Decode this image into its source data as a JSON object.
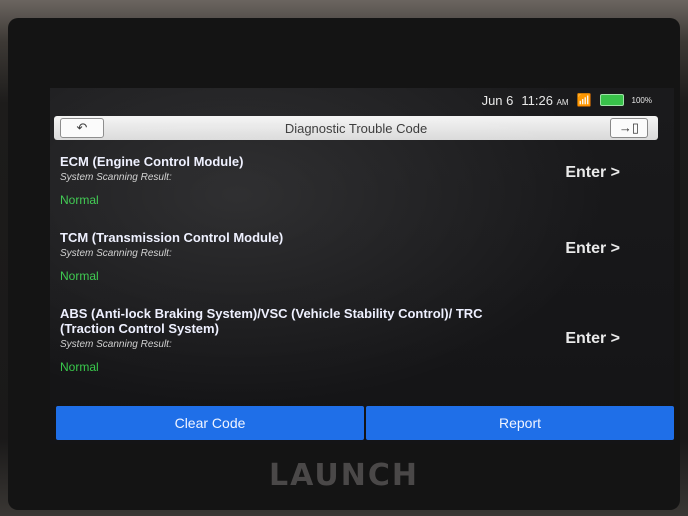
{
  "status_bar": {
    "date": "Jun 6",
    "time": "11:26",
    "ampm": "AM",
    "battery": "100%"
  },
  "title_bar": {
    "title": "Diagnostic Trouble Code"
  },
  "modules": [
    {
      "name": "ECM (Engine Control Module)",
      "sub": "System Scanning Result:",
      "status": "Normal",
      "enter": "Enter >"
    },
    {
      "name": "TCM (Transmission Control Module)",
      "sub": "System Scanning Result:",
      "status": "Normal",
      "enter": "Enter >"
    },
    {
      "name": "ABS (Anti-lock Braking System)/VSC (Vehicle Stability Control)/ TRC (Traction Control System)",
      "sub": "System Scanning Result:",
      "status": "Normal",
      "enter": "Enter >"
    }
  ],
  "bottom": {
    "clear": "Clear Code",
    "report": "Report"
  },
  "brand": "LAUNCH",
  "colors": {
    "accent": "#1f6fe8",
    "normal": "#37c94a"
  }
}
